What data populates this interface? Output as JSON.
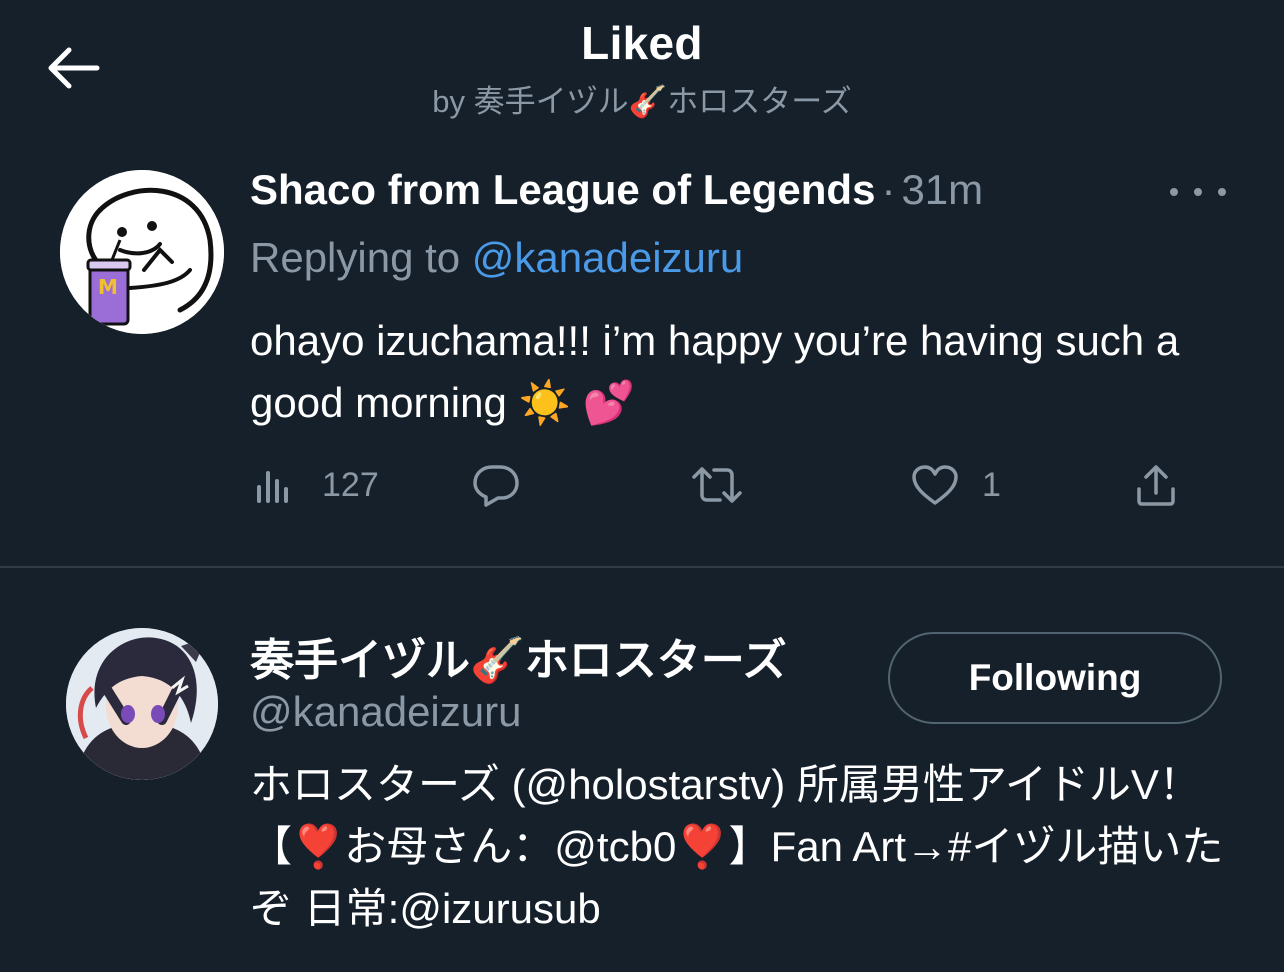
{
  "header": {
    "title": "Liked",
    "subtitle": "by 奏手イヅル🎸ホロスターズ"
  },
  "tweet": {
    "author_name": "Shaco from League of Legends",
    "separator": "·",
    "time": "31m",
    "replying_to_label": "Replying to ",
    "replying_to_handle": "@kanadeizuru",
    "text": "ohayo izuchama!!! i’m happy you’re having such a good morning ☀️ 💕",
    "views_count": "127",
    "likes_count": "1"
  },
  "profile": {
    "display_name": "奏手イヅル🎸ホロスターズ",
    "handle": "@kanadeizuru",
    "follow_button_label": "Following",
    "bio": "ホロスターズ (@holostarstv) 所属男性アイドルV！【❣️お母さん：@tcb0❣️】Fan Art→#イヅル描いたぞ 日常:@izurusub"
  },
  "colors": {
    "background": "#15202b",
    "secondary_text": "#8b98a5",
    "link": "#4a9ae8",
    "divider": "#2f3b47"
  },
  "icons": [
    "back-arrow-icon",
    "more-icon",
    "views-icon",
    "reply-icon",
    "retweet-icon",
    "like-icon",
    "share-icon"
  ]
}
